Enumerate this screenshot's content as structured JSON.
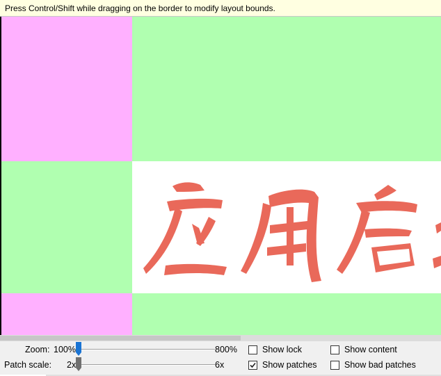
{
  "hint": {
    "text": "Press Control/Shift while dragging on the border to modify layout bounds."
  },
  "canvas": {
    "artwork_text": "应用启动",
    "colors": {
      "patch_stretch_both": "#ffb0ff",
      "patch_stretch_one": "#b0ffb0",
      "content": "#ffffff",
      "artwork": "#e9695a"
    }
  },
  "controls": {
    "zoom": {
      "label": "Zoom:",
      "min_label": "100%",
      "max_label": "800%",
      "value_fraction": 0.0,
      "thumb_color": "#1a74d4"
    },
    "patch_scale": {
      "label": "Patch scale:",
      "min_label": "2x",
      "max_label": "6x",
      "value_fraction": 0.0,
      "thumb_color": "#707070"
    },
    "checkboxes": [
      {
        "label": "Show lock",
        "checked": false
      },
      {
        "label": "Show content",
        "checked": false
      },
      {
        "label": "Show patches",
        "checked": true
      },
      {
        "label": "Show bad patches",
        "checked": false
      }
    ]
  }
}
